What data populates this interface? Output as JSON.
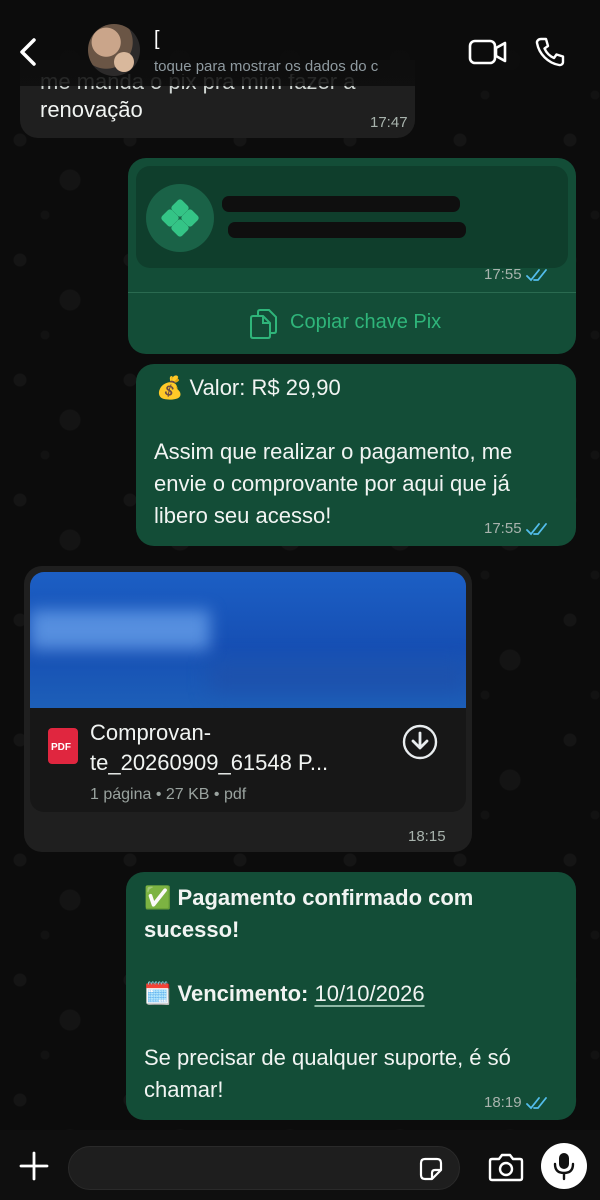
{
  "header": {
    "back_label": "Voltar",
    "contact_name": "[",
    "contact_status": "toque para mostrar os dados do c"
  },
  "messages": [
    {
      "type": "incoming-text",
      "partial_line": "me manda o pix pra mim fazer a",
      "text": "renovação",
      "time": "17:47"
    },
    {
      "type": "outgoing-pix",
      "copy_label": "Copiar chave Pix",
      "time": "17:55",
      "status": "read"
    },
    {
      "type": "outgoing-text",
      "emoji": "💰",
      "value_line": "Valor: R$ 29,90",
      "text_lines": [
        "Assim que realizar o pagamento, me",
        "envie o comprovante por aqui que já",
        "libero seu acesso!"
      ],
      "time": "17:55",
      "status": "read"
    },
    {
      "type": "incoming-document",
      "file_icon_label": "PDF",
      "file_name_line1": "Comprovan-",
      "file_name_line2": "te_20260909_61548 P...",
      "file_meta": "1 página • 27 KB • pdf",
      "time": "18:15"
    },
    {
      "type": "outgoing-text",
      "emoji_check": "✅",
      "headline_line1": "Pagamento confirmado com",
      "headline_line2": "sucesso!",
      "emoji_calendar": "🗓️",
      "due_label": "Vencimento:",
      "due_date": "10/10/2026",
      "support_line1": "Se precisar de qualquer suporte, é só",
      "support_line2": "chamar!",
      "time": "18:19",
      "status": "read"
    }
  ],
  "colors": {
    "outgoing_bubble": "#134d37",
    "incoming_bubble": "#1f1f1f",
    "pix_green": "#2fb57a",
    "read_ticks": "#53bdeb"
  }
}
